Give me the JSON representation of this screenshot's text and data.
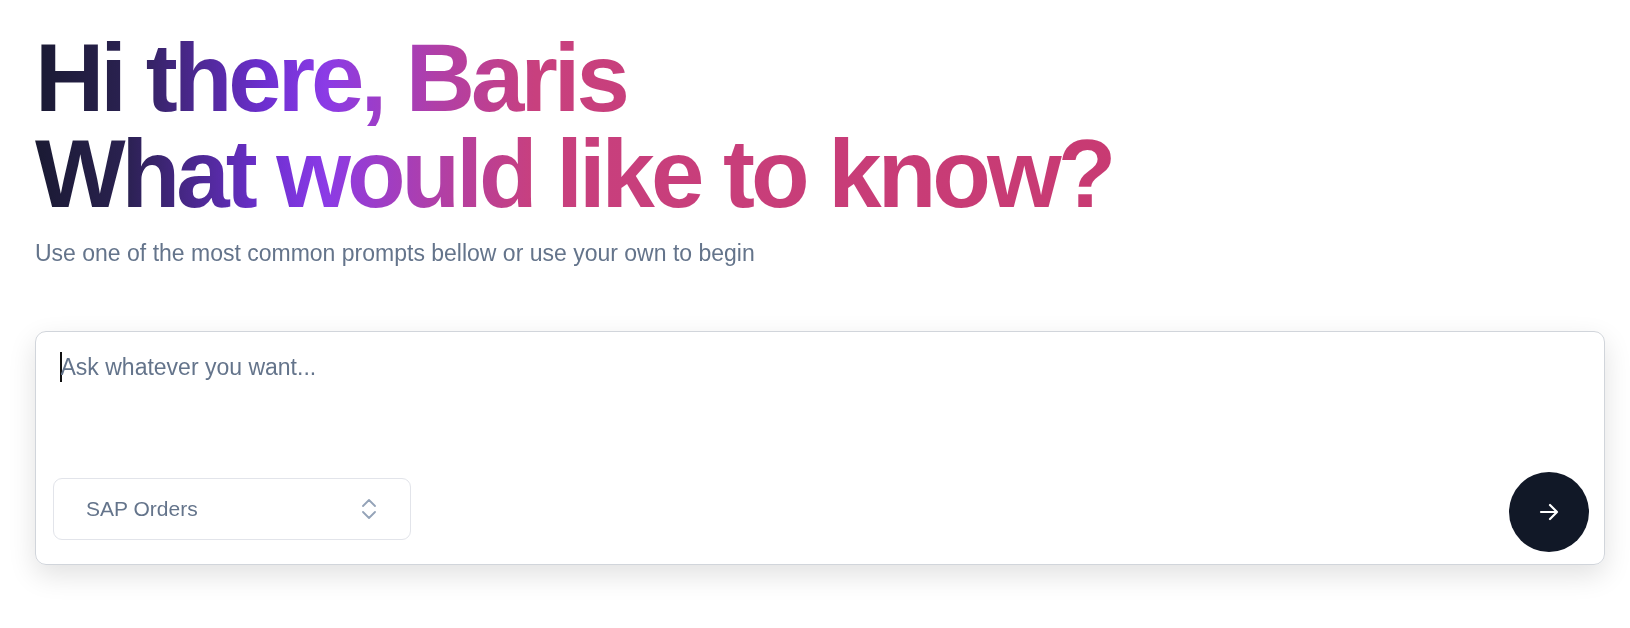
{
  "heading": {
    "lines": [
      "Hi there, Baris",
      "What would like to know?"
    ]
  },
  "subtitle": "Use one of the most common prompts bellow or use your own to begin",
  "prompt": {
    "placeholder": "Ask whatever you want...",
    "focused": true,
    "source_select": {
      "value": "SAP Orders"
    },
    "send_button": {
      "disabled": false
    }
  }
}
